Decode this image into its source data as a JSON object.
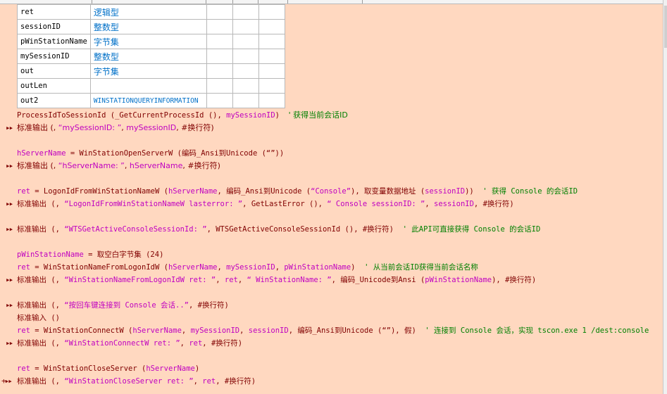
{
  "variables": [
    {
      "name": "ret",
      "type": "逻辑型"
    },
    {
      "name": "sessionID",
      "type": "整数型"
    },
    {
      "name": "pWinStationName",
      "type": "字节集"
    },
    {
      "name": "mySessionID",
      "type": "整数型"
    },
    {
      "name": "out",
      "type": "字节集"
    },
    {
      "name": "outLen",
      "type": ""
    },
    {
      "name": "out2",
      "type": "WINSTATIONQUERYINFORMATION"
    }
  ],
  "code": {
    "l1a": "ProcessIdToSessionId (_GetCurrentProcessId (), ",
    "l1b": "mySessionID",
    "l1c": ")  ",
    "l1d": "' 获得当前会话ID",
    "l2a": "标准输出 (, ",
    "l2b": "“mySessionID: ”",
    "l2c": ", ",
    "l2d": "mySessionID",
    "l2e": ", #换行符)",
    "l3a": "hServerName",
    "l3b": " = WinStationOpenServerW (编码_Ansi到Unicode (“”))",
    "l4a": "标准输出 (, ",
    "l4b": "“hServerName: ”",
    "l4c": ", ",
    "l4d": "hServerName",
    "l4e": ", #换行符)",
    "l5a": "ret",
    "l5b": " = LogonIdFromWinStationNameW (",
    "l5c": "hServerName",
    "l5d": ", 编码_Ansi到Unicode (",
    "l5e": "“Console”",
    "l5f": "), 取变量数据地址 (",
    "l5g": "sessionID",
    "l5h": "))  ",
    "l5i": "' 获得 Console 的会话ID",
    "l6a": "标准输出 (, ",
    "l6b": "“LogonIdFromWinStationNameW lasterror: ”",
    "l6c": ", GetLastError (), ",
    "l6d": "“ Console sessionID: ”",
    "l6e": ", ",
    "l6f": "sessionID",
    "l6g": ", #换行符)",
    "l7a": "标准输出 (, ",
    "l7b": "“WTSGetActiveConsoleSessionId: ”",
    "l7c": ", WTSGetActiveConsoleSessionId (), #换行符)  ",
    "l7d": "' 此API可直接获得 Console 的会话ID",
    "l8a": "pWinStationName",
    "l8b": " = 取空白字节集 (24)",
    "l9a": "ret",
    "l9b": " = WinStationNameFromLogonIdW (",
    "l9c": "hServerName",
    "l9d": ", ",
    "l9e": "mySessionID",
    "l9f": ", ",
    "l9g": "pWinStationName",
    "l9h": ")  ",
    "l9i": "' 从当前会话ID获得当前会话名称",
    "l10a": "标准输出 (, ",
    "l10b": "“WinStationNameFromLogonIdW ret: ”",
    "l10c": ", ",
    "l10d": "ret",
    "l10e": ", ",
    "l10f": "“ WinStationName: ”",
    "l10g": ", 编码_Unicode到Ansi (",
    "l10h": "pWinStationName",
    "l10i": "), #换行符)",
    "l11a": "标准输出 (, ",
    "l11b": "“按回车键连接到 Console 会话..”",
    "l11c": ", #换行符)",
    "l12": "标准输入 ()",
    "l13a": "ret",
    "l13b": " = WinStationConnectW (",
    "l13c": "hServerName",
    "l13d": ", ",
    "l13e": "mySessionID",
    "l13f": ", ",
    "l13g": "sessionID",
    "l13h": ", 编码_Ansi到Unicode (“”), 假)  ",
    "l13i": "' 连接到 Console 会话，实现 tscon.exe 1 /dest:console",
    "l14a": "标准输出 (, ",
    "l14b": "“WinStationConnectW ret: ”",
    "l14c": ", ",
    "l14d": "ret",
    "l14e": ", #换行符)",
    "l15a": "ret",
    "l15b": " = WinStationCloseServer (",
    "l15c": "hServerName",
    "l15d": ")",
    "l16a": "标准输出 (, ",
    "l16b": "“WinStationCloseServer ret: ”",
    "l16c": ", ",
    "l16d": "ret",
    "l16e": ", #换行符)"
  },
  "markers": {
    "output": "▸▸",
    "plus": "+▸▸"
  }
}
